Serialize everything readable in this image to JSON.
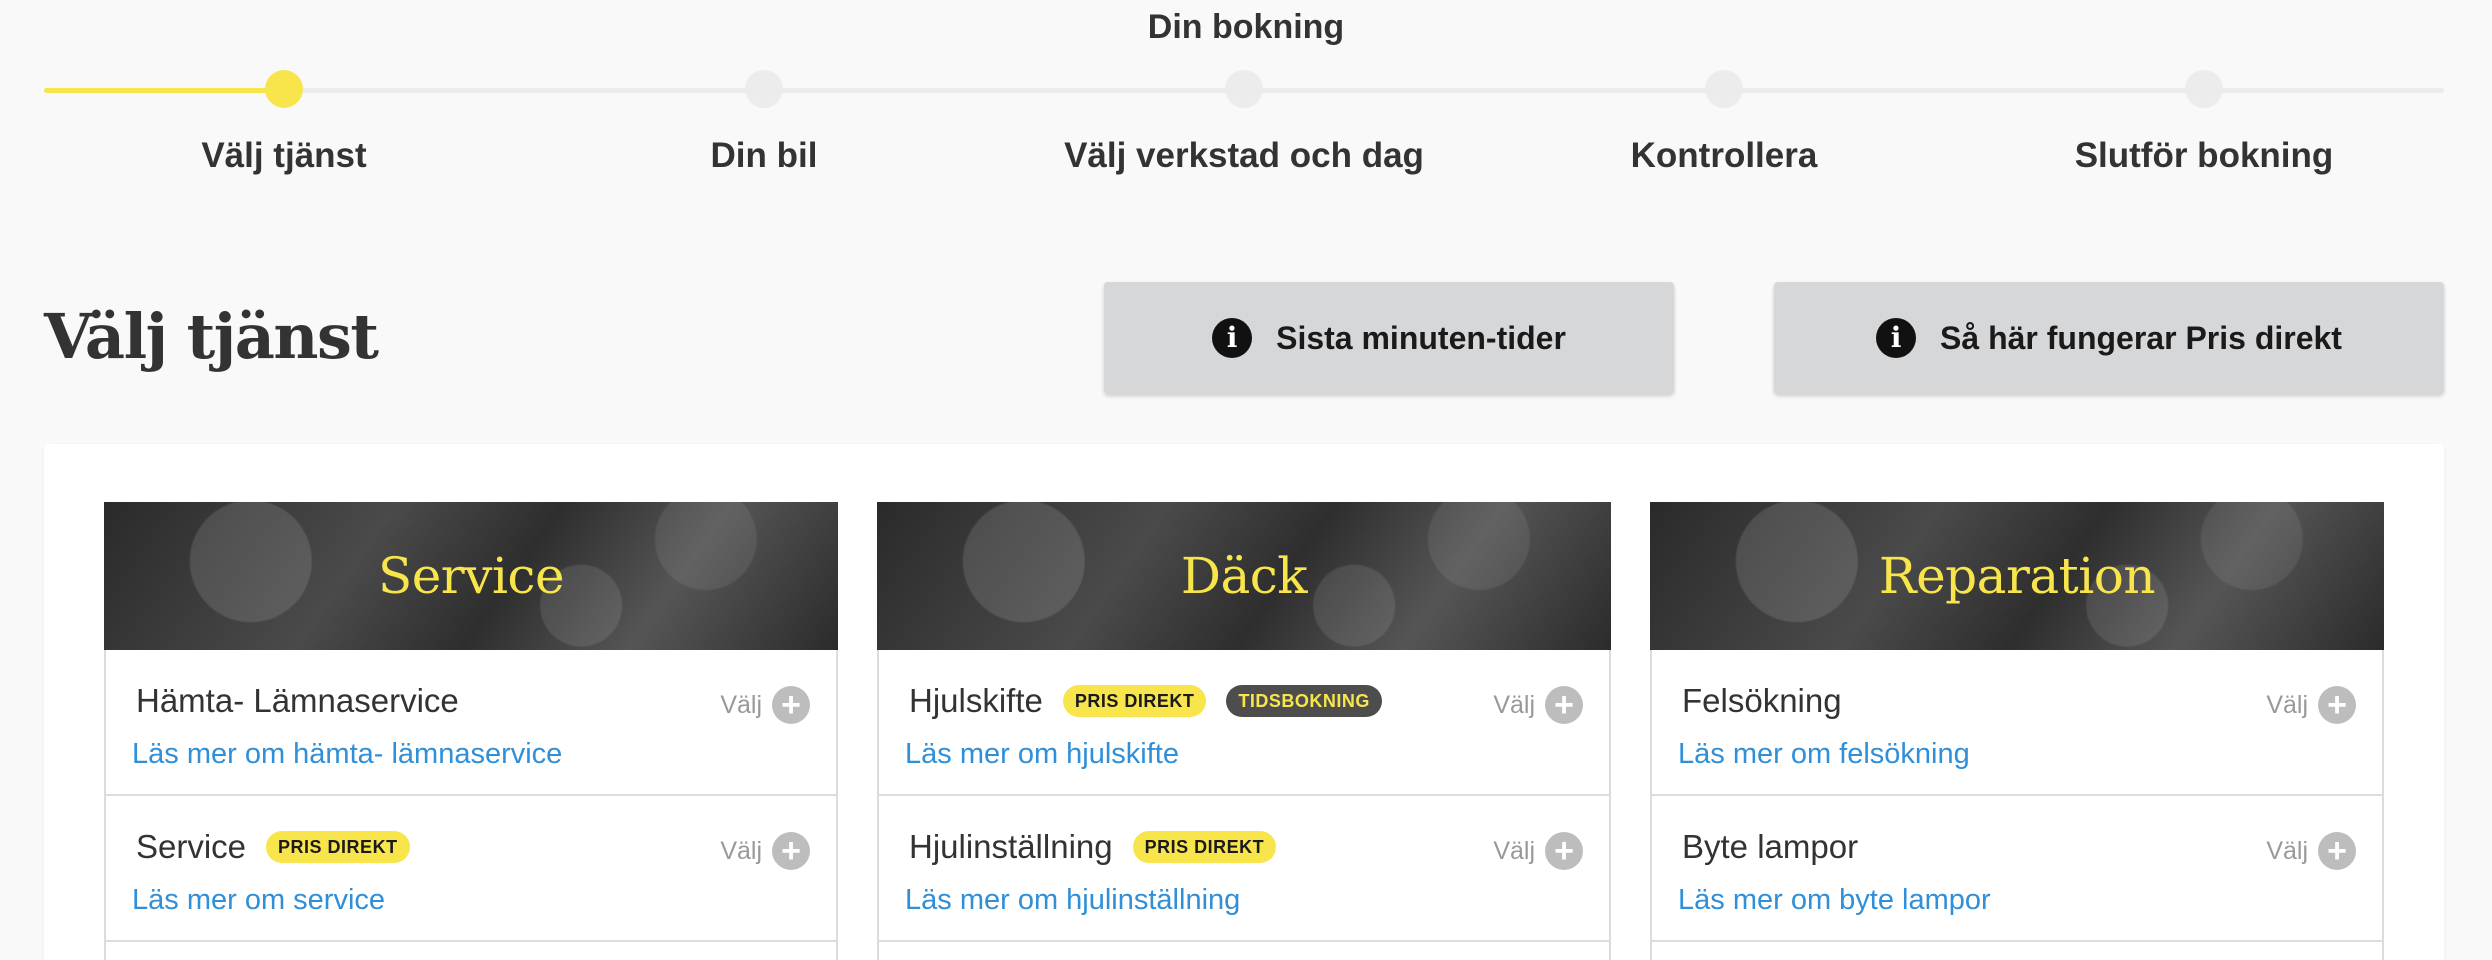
{
  "stepper": {
    "title": "Din bokning",
    "steps": [
      {
        "label": "Välj tjänst",
        "active": true
      },
      {
        "label": "Din bil",
        "active": false
      },
      {
        "label": "Välj verkstad och dag",
        "active": false
      },
      {
        "label": "Kontrollera",
        "active": false
      },
      {
        "label": "Slutför bokning",
        "active": false
      }
    ]
  },
  "page": {
    "title": "Välj tjänst",
    "buttons": [
      {
        "label": "Sista minuten-tider",
        "icon": "info-icon"
      },
      {
        "label": "Så här fungerar Pris direkt",
        "icon": "info-icon"
      }
    ]
  },
  "categories": [
    {
      "title": "Service",
      "items": [
        {
          "name": "Hämta- Lämnaservice",
          "badges": [],
          "link": "Läs mer om hämta- lämnaservice",
          "select_label": "Välj"
        },
        {
          "name": "Service",
          "badges": [
            "PRIS DIREKT"
          ],
          "link": "Läs mer om service",
          "select_label": "Välj"
        }
      ]
    },
    {
      "title": "Däck",
      "items": [
        {
          "name": "Hjulskifte",
          "badges": [
            "PRIS DIREKT",
            "TIDSBOKNING"
          ],
          "link": "Läs mer om hjulskifte",
          "select_label": "Välj"
        },
        {
          "name": "Hjulinställning",
          "badges": [
            "PRIS DIREKT"
          ],
          "link": "Läs mer om hjulinställning",
          "select_label": "Välj"
        }
      ]
    },
    {
      "title": "Reparation",
      "items": [
        {
          "name": "Felsökning",
          "badges": [],
          "link": "Läs mer om felsökning",
          "select_label": "Välj"
        },
        {
          "name": "Byte lampor",
          "badges": [],
          "link": "Läs mer om byte lampor",
          "select_label": "Välj"
        }
      ]
    }
  ],
  "colors": {
    "accent": "#f8e54c",
    "link": "#2f8fd8",
    "dark_badge": "#4d4d4d"
  }
}
